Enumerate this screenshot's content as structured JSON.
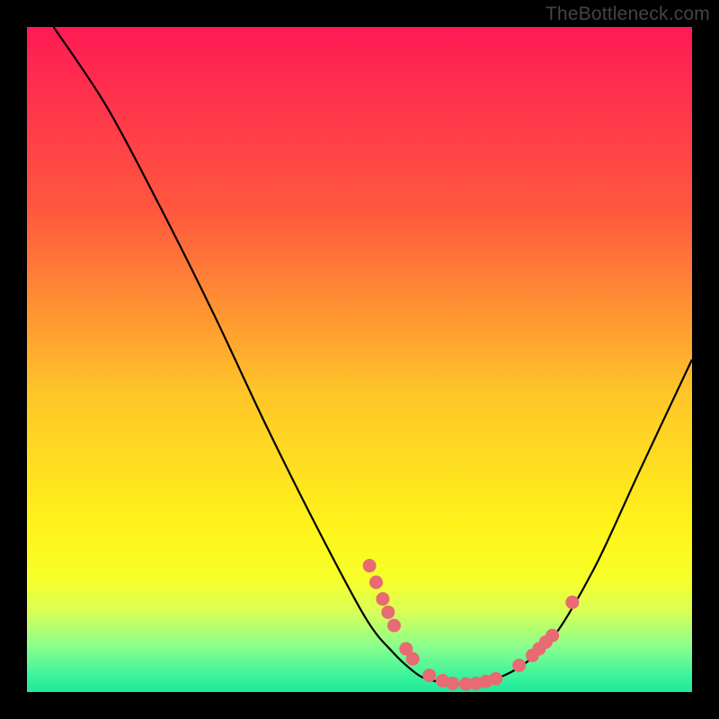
{
  "watermark": "TheBottleneck.com",
  "chart_data": {
    "type": "line",
    "title": "",
    "xlabel": "",
    "ylabel": "",
    "xlim": [
      0,
      100
    ],
    "ylim": [
      0,
      100
    ],
    "grid": false,
    "series": [
      {
        "name": "curve",
        "points": [
          {
            "x": 4,
            "y": 100
          },
          {
            "x": 12,
            "y": 88
          },
          {
            "x": 20,
            "y": 73
          },
          {
            "x": 28,
            "y": 57
          },
          {
            "x": 36,
            "y": 40
          },
          {
            "x": 44,
            "y": 24
          },
          {
            "x": 51,
            "y": 11
          },
          {
            "x": 55,
            "y": 6
          },
          {
            "x": 58,
            "y": 3.2
          },
          {
            "x": 60,
            "y": 2.0
          },
          {
            "x": 63,
            "y": 1.4
          },
          {
            "x": 66,
            "y": 1.2
          },
          {
            "x": 69,
            "y": 1.6
          },
          {
            "x": 72,
            "y": 2.6
          },
          {
            "x": 75,
            "y": 4.4
          },
          {
            "x": 78,
            "y": 7.0
          },
          {
            "x": 81,
            "y": 11
          },
          {
            "x": 86,
            "y": 20
          },
          {
            "x": 92,
            "y": 33
          },
          {
            "x": 100,
            "y": 50
          }
        ]
      }
    ],
    "markers": [
      {
        "x": 51.5,
        "y": 19
      },
      {
        "x": 52.5,
        "y": 16.5
      },
      {
        "x": 53.5,
        "y": 14
      },
      {
        "x": 54.3,
        "y": 12
      },
      {
        "x": 55.2,
        "y": 10
      },
      {
        "x": 57.0,
        "y": 6.5
      },
      {
        "x": 58.0,
        "y": 5
      },
      {
        "x": 60.5,
        "y": 2.5
      },
      {
        "x": 62.5,
        "y": 1.7
      },
      {
        "x": 64.0,
        "y": 1.3
      },
      {
        "x": 66.0,
        "y": 1.2
      },
      {
        "x": 67.5,
        "y": 1.3
      },
      {
        "x": 69.0,
        "y": 1.6
      },
      {
        "x": 70.5,
        "y": 2.0
      },
      {
        "x": 74.0,
        "y": 4.0
      },
      {
        "x": 76.0,
        "y": 5.5
      },
      {
        "x": 77.0,
        "y": 6.5
      },
      {
        "x": 78.0,
        "y": 7.5
      },
      {
        "x": 79.0,
        "y": 8.5
      },
      {
        "x": 82.0,
        "y": 13.5
      }
    ],
    "gradient_stops": [
      {
        "offset": 0.0,
        "color": "#ff1a55"
      },
      {
        "offset": 0.28,
        "color": "#ff593e"
      },
      {
        "offset": 0.55,
        "color": "#ffc529"
      },
      {
        "offset": 0.75,
        "color": "#fff31a"
      },
      {
        "offset": 0.83,
        "color": "#f7ff2a"
      },
      {
        "offset": 0.88,
        "color": "#d8ff57"
      },
      {
        "offset": 0.93,
        "color": "#8cff8c"
      },
      {
        "offset": 0.98,
        "color": "#35f29d"
      },
      {
        "offset": 1.0,
        "color": "#1fe89b"
      }
    ],
    "marker_color": "#e86a72",
    "line_color": "#000000"
  }
}
